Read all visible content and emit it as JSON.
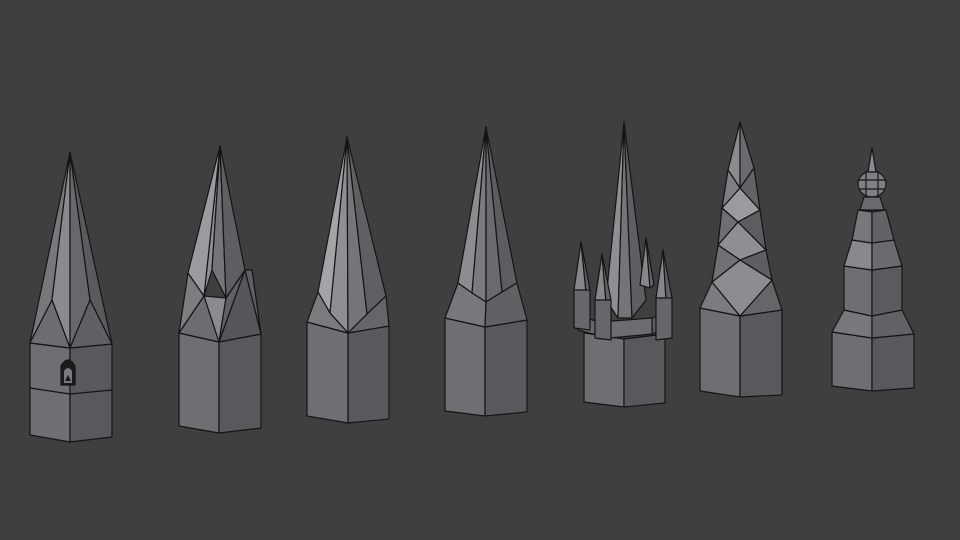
{
  "viewport": {
    "background_color": "#3f3f3f",
    "shading": "solid-gray-with-wireframe-edges"
  },
  "palette": {
    "face_light": "#9a9a9e",
    "face_mid": "#77777c",
    "face_dark": "#5c5c61",
    "face_shadow": "#4d4d52",
    "edge": "#151515"
  },
  "objects": [
    {
      "id": "spire-1",
      "style": "tall-pyramid-spire-with-arched-window",
      "has_window": true
    },
    {
      "id": "spire-2",
      "style": "star-pinnacle-spire"
    },
    {
      "id": "spire-3",
      "style": "smooth-octagonal-spire"
    },
    {
      "id": "spire-4",
      "style": "faceted-spire-on-square-tower"
    },
    {
      "id": "spire-5",
      "style": "spire-with-four-corner-pinnacles"
    },
    {
      "id": "spire-6",
      "style": "twisted-spire"
    },
    {
      "id": "spire-7",
      "style": "onion-dome-tiered-spire"
    }
  ]
}
